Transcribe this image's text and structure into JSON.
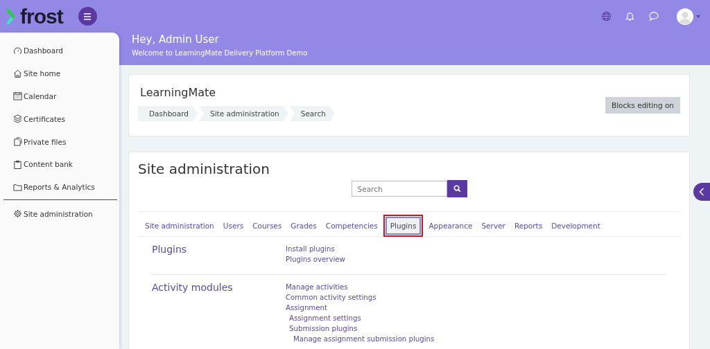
{
  "header": {
    "logo": "frost",
    "greeting": "Hey, Admin User",
    "welcome": "Welcome to LearningMate Delivery Platform Demo"
  },
  "sidebar": {
    "items": [
      {
        "label": "Dashboard"
      },
      {
        "label": "Site home"
      },
      {
        "label": "Calendar"
      },
      {
        "label": "Certificates"
      },
      {
        "label": "Private files"
      },
      {
        "label": "Content bank"
      },
      {
        "label": "Reports & Analytics"
      }
    ],
    "admin_item": {
      "label": "Site administration"
    }
  },
  "page_header": {
    "title": "LearningMate",
    "breadcrumbs": [
      "Dashboard",
      "Site administration",
      "Search"
    ],
    "edit_button": "Blocks editing on"
  },
  "admin": {
    "title": "Site administration",
    "search": {
      "placeholder": "Search"
    },
    "tabs": [
      {
        "label": "Site administration",
        "selected": false
      },
      {
        "label": "Users",
        "selected": false
      },
      {
        "label": "Courses",
        "selected": false
      },
      {
        "label": "Grades",
        "selected": false
      },
      {
        "label": "Competencies",
        "selected": false
      },
      {
        "label": "Plugins",
        "selected": true
      },
      {
        "label": "Appearance",
        "selected": false
      },
      {
        "label": "Server",
        "selected": false
      },
      {
        "label": "Reports",
        "selected": false
      },
      {
        "label": "Development",
        "selected": false
      }
    ],
    "sections": [
      {
        "heading": "Plugins",
        "links": [
          {
            "label": "Install plugins"
          },
          {
            "label": "Plugins overview"
          }
        ]
      },
      {
        "heading": "Activity modules",
        "links": [
          {
            "label": "Manage activities"
          },
          {
            "label": "Common activity settings"
          },
          {
            "label": "Assignment",
            "children": [
              {
                "label": "Assignment settings"
              },
              {
                "label": "Submission plugins",
                "children": [
                  {
                    "label": "Manage assignment submission plugins"
                  }
                ]
              }
            ]
          }
        ]
      }
    ]
  }
}
